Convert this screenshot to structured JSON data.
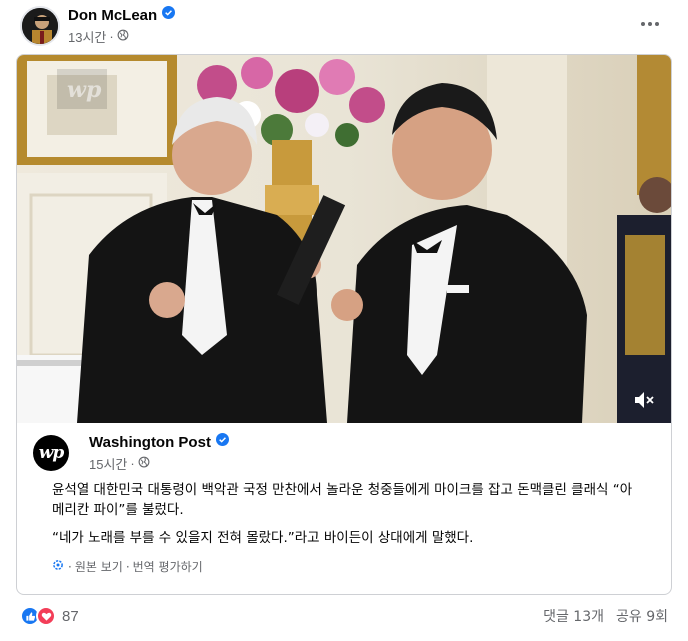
{
  "author": {
    "name": "Don McLean",
    "time": "13시간",
    "verified": true
  },
  "shared": {
    "source_name": "Washington Post",
    "time": "15시간",
    "verified": true,
    "logo_text": "wp",
    "paragraphs": [
      "윤석열 대한민국 대통령이 백악관 국정 만찬에서 놀라운 청중들에게 마이크를 잡고 돈맥클린 클래식 “아메리칸 파이”를 불렀다.",
      "“네가 노래를 부를 수 있을지 전혀 몰랐다.”라고 바이든이 상대에게 말했다."
    ],
    "see_original": "원본 보기",
    "separator": "·",
    "rate_translation": "번역 평가하기"
  },
  "footer": {
    "reaction_count": "87",
    "comments": "댓글 13개",
    "shares": "공유 9회"
  },
  "colors": {
    "accent": "#1877f2",
    "love": "#f33e58",
    "secondary_text": "#65676b"
  },
  "icons": {
    "verified": "verified-badge-icon",
    "privacy": "globe-icon",
    "more": "more-options-icon",
    "mute": "speaker-muted-icon",
    "translate": "gear-icon",
    "like": "like-icon",
    "love": "love-icon"
  }
}
